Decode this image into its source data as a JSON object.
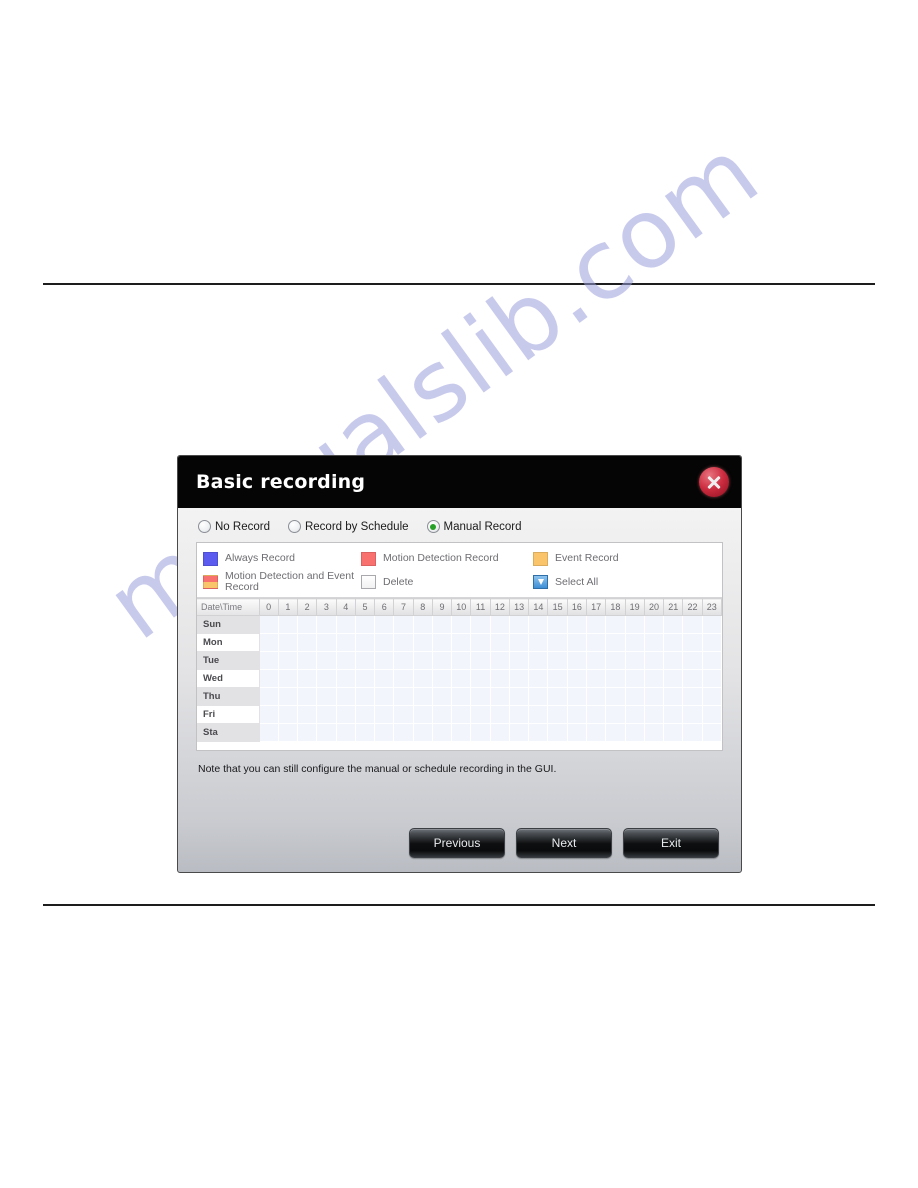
{
  "watermark": {
    "text": "manualslib.com"
  },
  "dialog": {
    "title": "Basic recording",
    "close_icon": "close-icon",
    "record_modes": [
      {
        "label": "No Record",
        "selected": false
      },
      {
        "label": "Record by Schedule",
        "selected": false
      },
      {
        "label": "Manual Record",
        "selected": true
      }
    ],
    "legend": [
      {
        "label": "Always Record",
        "swatch": "blue",
        "color": "#5b5bf0"
      },
      {
        "label": "Motion Detection Record",
        "swatch": "red",
        "color": "#f9716f"
      },
      {
        "label": "Event Record",
        "swatch": "orange",
        "color": "#f9c46a"
      },
      {
        "label": "Motion Detection and Event Record",
        "swatch": "split",
        "color": "#f9716f"
      },
      {
        "label": "Delete",
        "swatch": "checkbox",
        "color": "#ffffff"
      },
      {
        "label": "Select All",
        "swatch": "select-all",
        "color": "#3d8fd4"
      }
    ],
    "schedule": {
      "corner_header": "Date\\Time",
      "hours": [
        "0",
        "1",
        "2",
        "3",
        "4",
        "5",
        "6",
        "7",
        "8",
        "9",
        "10",
        "11",
        "12",
        "13",
        "14",
        "15",
        "16",
        "17",
        "18",
        "19",
        "20",
        "21",
        "22",
        "23"
      ],
      "days": [
        "Sun",
        "Mon",
        "Tue",
        "Wed",
        "Thu",
        "Fri",
        "Sta"
      ]
    },
    "note": "Note that you can still configure the manual or schedule recording in the GUI.",
    "buttons": [
      {
        "label": "Previous"
      },
      {
        "label": "Next"
      },
      {
        "label": "Exit"
      }
    ]
  }
}
